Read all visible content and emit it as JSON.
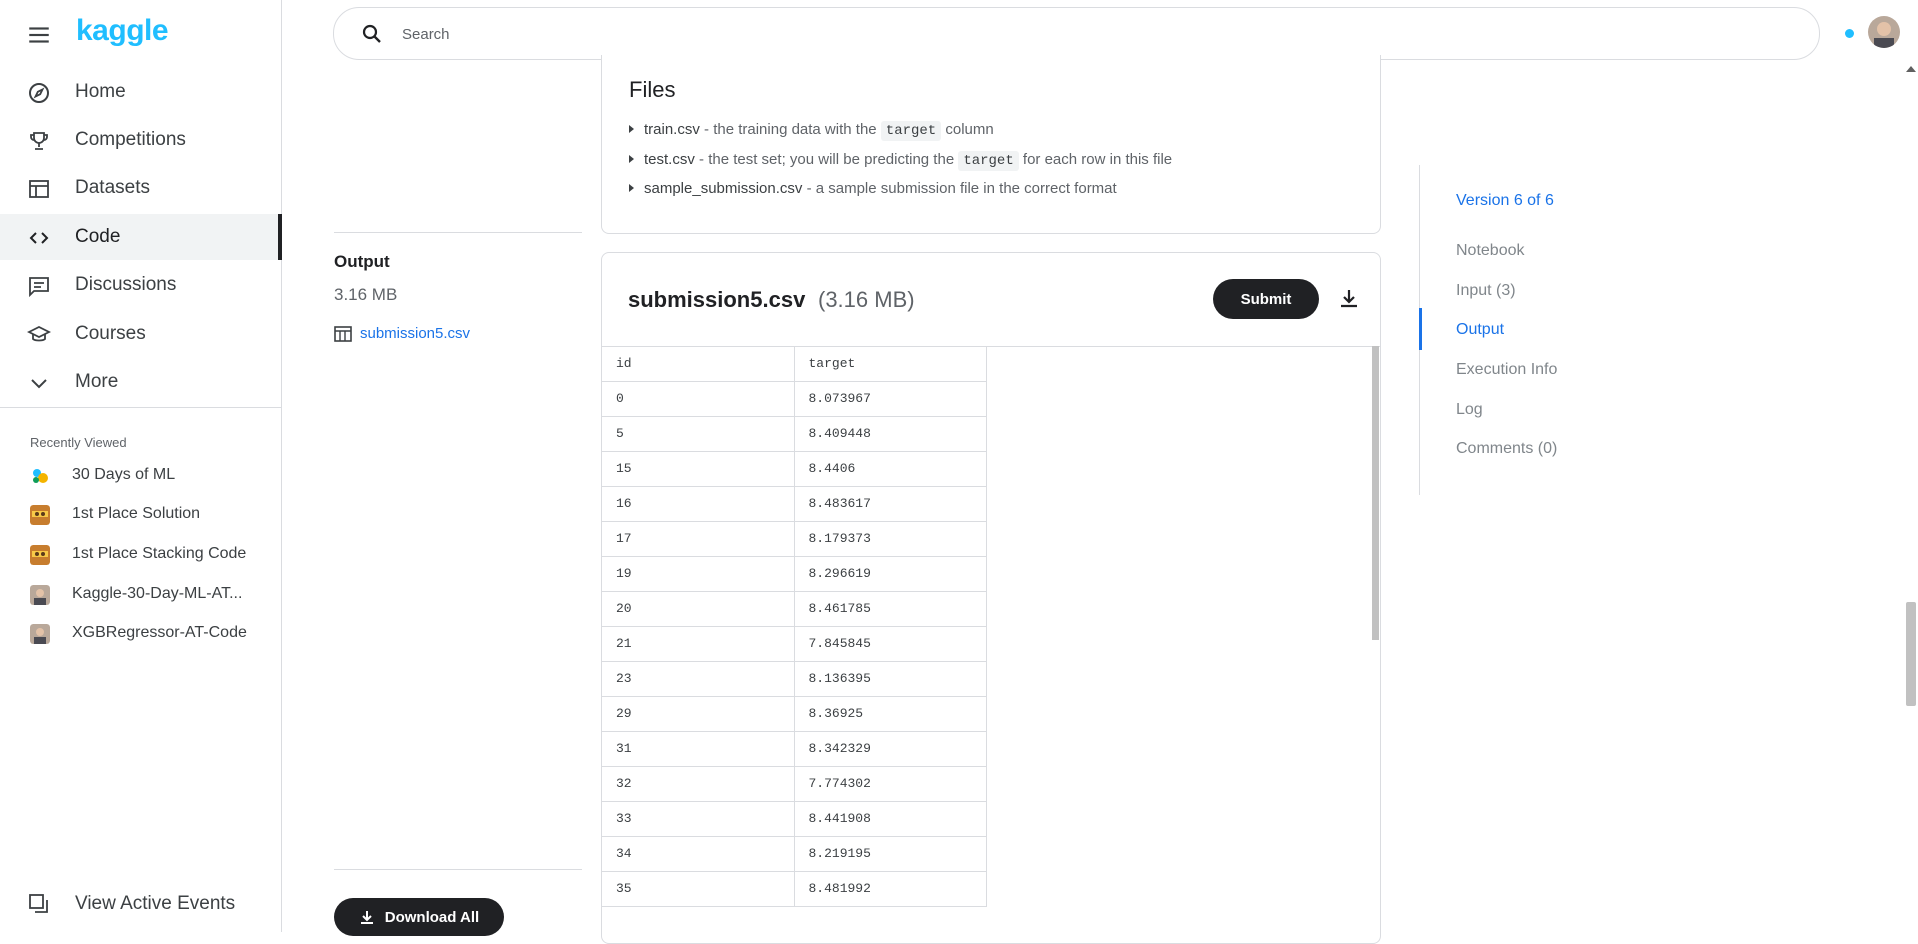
{
  "app": {
    "logo": "kaggle"
  },
  "search": {
    "placeholder": "Search"
  },
  "sidebar": {
    "nav": [
      {
        "label": "Home",
        "icon": "compass-icon"
      },
      {
        "label": "Competitions",
        "icon": "trophy-icon"
      },
      {
        "label": "Datasets",
        "icon": "table-icon"
      },
      {
        "label": "Code",
        "icon": "code-icon",
        "active": true
      },
      {
        "label": "Discussions",
        "icon": "comment-icon"
      },
      {
        "label": "Courses",
        "icon": "school-icon"
      },
      {
        "label": "More",
        "icon": "chevron-down-icon"
      }
    ],
    "recently_viewed_title": "Recently Viewed",
    "recently_viewed": [
      {
        "label": "30 Days of ML"
      },
      {
        "label": "1st Place Solution"
      },
      {
        "label": "1st Place Stacking Code"
      },
      {
        "label": "Kaggle-30-Day-ML-AT..."
      },
      {
        "label": "XGBRegressor-AT-Code"
      }
    ],
    "view_events": "View Active Events"
  },
  "files": {
    "title": "Files",
    "items": [
      {
        "name": "train.csv",
        "pre": " - the training data with the ",
        "code": "target",
        "post": " column"
      },
      {
        "name": "test.csv",
        "pre": " - the test set; you will be predicting the ",
        "code": "target",
        "post": " for each row in this file"
      },
      {
        "name": "sample_submission.csv",
        "pre": " - a sample submission file in the correct format",
        "code": "",
        "post": ""
      }
    ]
  },
  "output": {
    "label": "Output",
    "size": "3.16 MB",
    "file_link": "submission5.csv",
    "download_all": "Download All"
  },
  "submission": {
    "filename": "submission5.csv",
    "filesize": "(3.16 MB)",
    "submit_label": "Submit",
    "columns": [
      "id",
      "target"
    ],
    "rows": [
      [
        "0",
        "8.073967"
      ],
      [
        "5",
        "8.409448"
      ],
      [
        "15",
        "8.4406"
      ],
      [
        "16",
        "8.483617"
      ],
      [
        "17",
        "8.179373"
      ],
      [
        "19",
        "8.296619"
      ],
      [
        "20",
        "8.461785"
      ],
      [
        "21",
        "7.845845"
      ],
      [
        "23",
        "8.136395"
      ],
      [
        "29",
        "8.36925"
      ],
      [
        "31",
        "8.342329"
      ],
      [
        "32",
        "7.774302"
      ],
      [
        "33",
        "8.441908"
      ],
      [
        "34",
        "8.219195"
      ],
      [
        "35",
        "8.481992"
      ]
    ]
  },
  "toc": {
    "version": "Version 6 of 6",
    "items": [
      {
        "label": "Notebook"
      },
      {
        "label": "Input (3)"
      },
      {
        "label": "Output",
        "active": true
      },
      {
        "label": "Execution Info"
      },
      {
        "label": "Log"
      },
      {
        "label": "Comments (0)"
      }
    ]
  },
  "colors": {
    "brand": "#20beff",
    "link": "#1a73e8",
    "dark_button": "#202124"
  }
}
